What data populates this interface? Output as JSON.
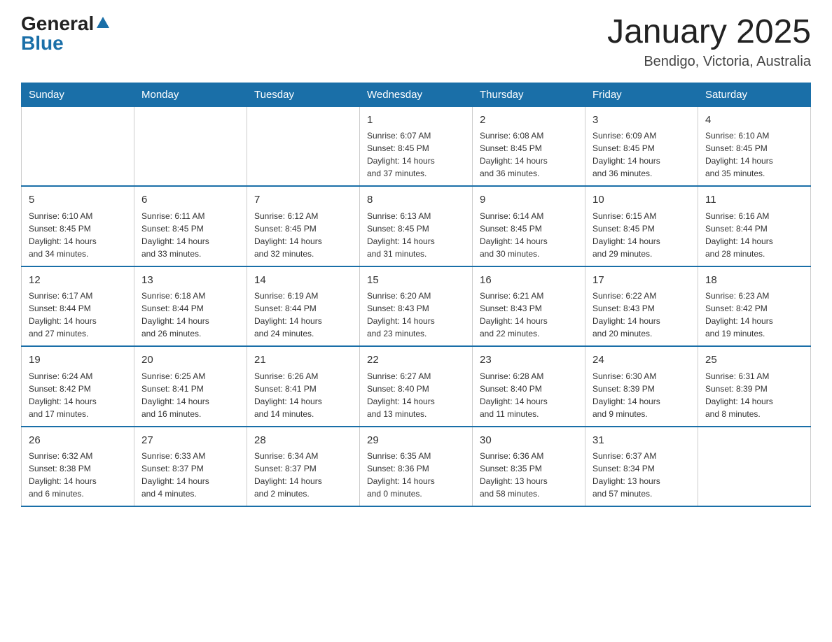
{
  "logo": {
    "general": "General",
    "blue": "Blue"
  },
  "title": "January 2025",
  "location": "Bendigo, Victoria, Australia",
  "headers": [
    "Sunday",
    "Monday",
    "Tuesday",
    "Wednesday",
    "Thursday",
    "Friday",
    "Saturday"
  ],
  "weeks": [
    [
      {
        "day": "",
        "info": ""
      },
      {
        "day": "",
        "info": ""
      },
      {
        "day": "",
        "info": ""
      },
      {
        "day": "1",
        "info": "Sunrise: 6:07 AM\nSunset: 8:45 PM\nDaylight: 14 hours\nand 37 minutes."
      },
      {
        "day": "2",
        "info": "Sunrise: 6:08 AM\nSunset: 8:45 PM\nDaylight: 14 hours\nand 36 minutes."
      },
      {
        "day": "3",
        "info": "Sunrise: 6:09 AM\nSunset: 8:45 PM\nDaylight: 14 hours\nand 36 minutes."
      },
      {
        "day": "4",
        "info": "Sunrise: 6:10 AM\nSunset: 8:45 PM\nDaylight: 14 hours\nand 35 minutes."
      }
    ],
    [
      {
        "day": "5",
        "info": "Sunrise: 6:10 AM\nSunset: 8:45 PM\nDaylight: 14 hours\nand 34 minutes."
      },
      {
        "day": "6",
        "info": "Sunrise: 6:11 AM\nSunset: 8:45 PM\nDaylight: 14 hours\nand 33 minutes."
      },
      {
        "day": "7",
        "info": "Sunrise: 6:12 AM\nSunset: 8:45 PM\nDaylight: 14 hours\nand 32 minutes."
      },
      {
        "day": "8",
        "info": "Sunrise: 6:13 AM\nSunset: 8:45 PM\nDaylight: 14 hours\nand 31 minutes."
      },
      {
        "day": "9",
        "info": "Sunrise: 6:14 AM\nSunset: 8:45 PM\nDaylight: 14 hours\nand 30 minutes."
      },
      {
        "day": "10",
        "info": "Sunrise: 6:15 AM\nSunset: 8:45 PM\nDaylight: 14 hours\nand 29 minutes."
      },
      {
        "day": "11",
        "info": "Sunrise: 6:16 AM\nSunset: 8:44 PM\nDaylight: 14 hours\nand 28 minutes."
      }
    ],
    [
      {
        "day": "12",
        "info": "Sunrise: 6:17 AM\nSunset: 8:44 PM\nDaylight: 14 hours\nand 27 minutes."
      },
      {
        "day": "13",
        "info": "Sunrise: 6:18 AM\nSunset: 8:44 PM\nDaylight: 14 hours\nand 26 minutes."
      },
      {
        "day": "14",
        "info": "Sunrise: 6:19 AM\nSunset: 8:44 PM\nDaylight: 14 hours\nand 24 minutes."
      },
      {
        "day": "15",
        "info": "Sunrise: 6:20 AM\nSunset: 8:43 PM\nDaylight: 14 hours\nand 23 minutes."
      },
      {
        "day": "16",
        "info": "Sunrise: 6:21 AM\nSunset: 8:43 PM\nDaylight: 14 hours\nand 22 minutes."
      },
      {
        "day": "17",
        "info": "Sunrise: 6:22 AM\nSunset: 8:43 PM\nDaylight: 14 hours\nand 20 minutes."
      },
      {
        "day": "18",
        "info": "Sunrise: 6:23 AM\nSunset: 8:42 PM\nDaylight: 14 hours\nand 19 minutes."
      }
    ],
    [
      {
        "day": "19",
        "info": "Sunrise: 6:24 AM\nSunset: 8:42 PM\nDaylight: 14 hours\nand 17 minutes."
      },
      {
        "day": "20",
        "info": "Sunrise: 6:25 AM\nSunset: 8:41 PM\nDaylight: 14 hours\nand 16 minutes."
      },
      {
        "day": "21",
        "info": "Sunrise: 6:26 AM\nSunset: 8:41 PM\nDaylight: 14 hours\nand 14 minutes."
      },
      {
        "day": "22",
        "info": "Sunrise: 6:27 AM\nSunset: 8:40 PM\nDaylight: 14 hours\nand 13 minutes."
      },
      {
        "day": "23",
        "info": "Sunrise: 6:28 AM\nSunset: 8:40 PM\nDaylight: 14 hours\nand 11 minutes."
      },
      {
        "day": "24",
        "info": "Sunrise: 6:30 AM\nSunset: 8:39 PM\nDaylight: 14 hours\nand 9 minutes."
      },
      {
        "day": "25",
        "info": "Sunrise: 6:31 AM\nSunset: 8:39 PM\nDaylight: 14 hours\nand 8 minutes."
      }
    ],
    [
      {
        "day": "26",
        "info": "Sunrise: 6:32 AM\nSunset: 8:38 PM\nDaylight: 14 hours\nand 6 minutes."
      },
      {
        "day": "27",
        "info": "Sunrise: 6:33 AM\nSunset: 8:37 PM\nDaylight: 14 hours\nand 4 minutes."
      },
      {
        "day": "28",
        "info": "Sunrise: 6:34 AM\nSunset: 8:37 PM\nDaylight: 14 hours\nand 2 minutes."
      },
      {
        "day": "29",
        "info": "Sunrise: 6:35 AM\nSunset: 8:36 PM\nDaylight: 14 hours\nand 0 minutes."
      },
      {
        "day": "30",
        "info": "Sunrise: 6:36 AM\nSunset: 8:35 PM\nDaylight: 13 hours\nand 58 minutes."
      },
      {
        "day": "31",
        "info": "Sunrise: 6:37 AM\nSunset: 8:34 PM\nDaylight: 13 hours\nand 57 minutes."
      },
      {
        "day": "",
        "info": ""
      }
    ]
  ]
}
